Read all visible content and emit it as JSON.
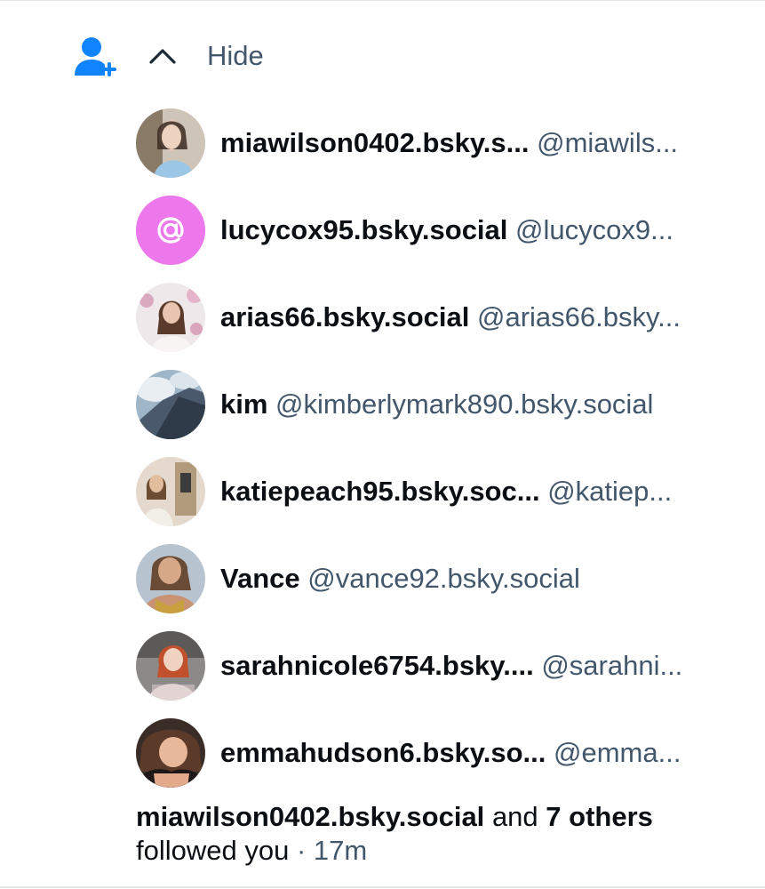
{
  "header": {
    "icon": "person-plus-icon",
    "accent_color": "#1083fe",
    "toggle_icon": "chevron-up-icon",
    "hide_label": "Hide"
  },
  "followers": [
    {
      "name": "miawilson0402.bsky.s...",
      "handle": "@miawils..."
    },
    {
      "name": "lucycox95.bsky.social",
      "handle": "@lucycox9..."
    },
    {
      "name": "arias66.bsky.social",
      "handle": "@arias66.bsky..."
    },
    {
      "name": "kim",
      "handle": "@kimberlymark890.bsky.social"
    },
    {
      "name": "katiepeach95.bsky.soc...",
      "handle": "@katiep..."
    },
    {
      "name": "Vance",
      "handle": "@vance92.bsky.social"
    },
    {
      "name": "sarahnicole6754.bsky....",
      "handle": "@sarahni..."
    },
    {
      "name": "emmahudson6.bsky.so...",
      "handle": "@emma..."
    }
  ],
  "default_avatar": {
    "icon": "at-sign-icon",
    "glyph": "@",
    "color": "#ec78ec"
  },
  "summary": {
    "first_name": "miawilson0402.bsky.social",
    "and_text": "and",
    "others": "7 others",
    "followed_text": "followed you",
    "separator": "·",
    "time": "17m"
  }
}
